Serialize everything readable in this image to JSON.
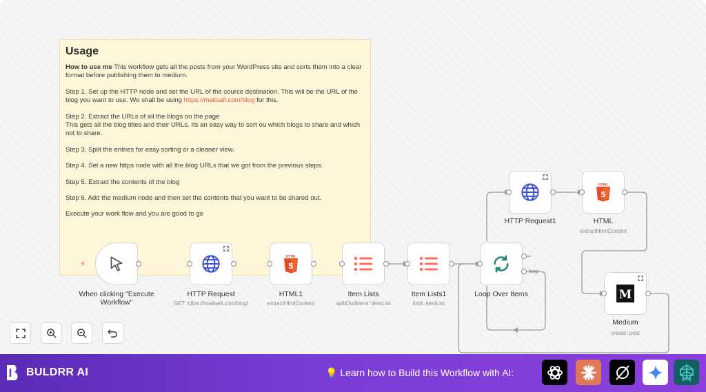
{
  "note": {
    "title": "Usage",
    "intro_bold": "How to use me",
    "intro": " This workflow gets all the posts from your WordPress site and sorts them into a clear format before publishing them to medium.",
    "step1_a": "Step 1. Set up the HTTP node and set the URL of the source destination. This will be the URL of the blog you want to use. We shall be using ",
    "step1_link": "https://mailsafi.com/blog",
    "step1_b": " for this.",
    "step2_a": "Step 2. Extract the URLs of all the blogs on the page",
    "step2_b": "This gets all the blog titles and their URLs. Its an easy way to sort ou which blogs to share and which not to share.",
    "step3": "Step 3. Split the entries for easy sorting or a cleaner view.",
    "step4": "Step 4. Set a new https node with all the blog URLs that we got from the previous steps.",
    "step5": "Step 5. Extract the contents of the blog",
    "step6": "Step 6. Add the medium node and then set the contents that you want to be shared out.",
    "outro": "Execute your work flow and you are good to go"
  },
  "nodes": {
    "trigger": {
      "label": "When clicking \"Execute Workflow\"",
      "icon": "cursor-icon"
    },
    "http_request": {
      "label": "HTTP Request",
      "sub": "GET: https://mailsafi.com/blog/",
      "icon": "globe-icon"
    },
    "html1": {
      "label": "HTML1",
      "sub": "extractHtmlContent",
      "icon": "html5-icon"
    },
    "item_lists": {
      "label": "Item Lists",
      "sub": "splitOutItems: itemList",
      "icon": "list-icon"
    },
    "item_lists1": {
      "label": "Item Lists1",
      "sub": "limit: itemList",
      "icon": "list-icon"
    },
    "loop": {
      "label": "Loop Over Items",
      "output_label": "loop",
      "icon": "refresh-icon"
    },
    "http_request1": {
      "label": "HTTP Request1",
      "icon": "globe-icon"
    },
    "html": {
      "label": "HTML",
      "sub": "extractHtmlContent",
      "icon": "html5-icon"
    },
    "medium": {
      "label": "Medium",
      "sub": "create: post",
      "icon": "medium-icon"
    }
  },
  "footer": {
    "brand": "BULDRR AI",
    "learn_text": "Learn how to Build this Workflow with AI:",
    "ai_icons": [
      "chatgpt-icon",
      "claude-icon",
      "grok-icon",
      "gemini-icon",
      "perplexity-icon"
    ]
  },
  "colors": {
    "accent": "#ff6d5a",
    "globe": "#3f51d6",
    "loop": "#1f8a74",
    "footer_start": "#5a2bb5",
    "footer_end": "#8b3fdc"
  }
}
